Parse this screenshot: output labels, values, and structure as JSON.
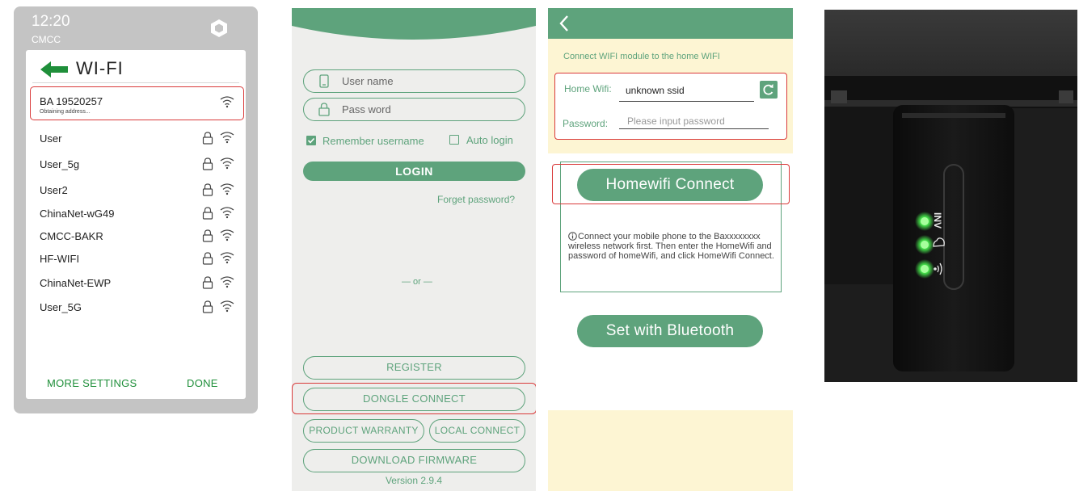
{
  "phone_wifi": {
    "status_time": "12:20",
    "carrier": "CMCC",
    "title": "WI-FI",
    "selected_network": {
      "ssid": "BA 19520257",
      "status": "Obtaining address..."
    },
    "networks": [
      "User",
      "User_5g",
      "User2",
      "ChinaNet-wG49",
      "CMCC-BAKR",
      "HF-WIFI",
      "ChinaNet-EWP",
      "User_5G"
    ],
    "more_settings": "MORE SETTINGS",
    "done": "DONE"
  },
  "login": {
    "username_placeholder": "User name",
    "password_placeholder": "Pass word",
    "remember_label": "Remember username",
    "remember_checked": true,
    "auto_login_label": "Auto login",
    "auto_login_checked": false,
    "login_button": "LOGIN",
    "forget_password": "Forget password?",
    "or_separator": "— or —",
    "register": "REGISTER",
    "dongle_connect": "DONGLE CONNECT",
    "product_warranty": "PRODUCT WARRANTY",
    "local_connect": "LOCAL CONNECT",
    "download_firmware": "DOWNLOAD FIRMWARE",
    "version": "Version 2.9.4"
  },
  "wifi_config": {
    "heading": "Connect WIFI module to the home WIFI",
    "home_wifi_label": "Home Wifi:",
    "home_wifi_value": "unknown ssid",
    "password_label": "Password:",
    "password_placeholder": "Please input password",
    "homewifi_connect": "Homewifi Connect",
    "info_icon": "info-icon",
    "info_text": "Connect your mobile phone to the Baxxxxxxxx wireless network first. Then enter the HomeWifi and password of homeWifi, and click HomeWifi Connect.",
    "set_bluetooth": "Set with Bluetooth"
  },
  "device_photo": {
    "led_labels": [
      "INV",
      "cloud-icon",
      "wireless-icon"
    ]
  },
  "colors": {
    "app_green": "#5ea37c",
    "highlight_red": "#d93a3a",
    "android_green": "#1f8f3a",
    "cream": "#fdf5d3",
    "login_bg": "#eeeeec",
    "led_green": "#44e04a"
  }
}
